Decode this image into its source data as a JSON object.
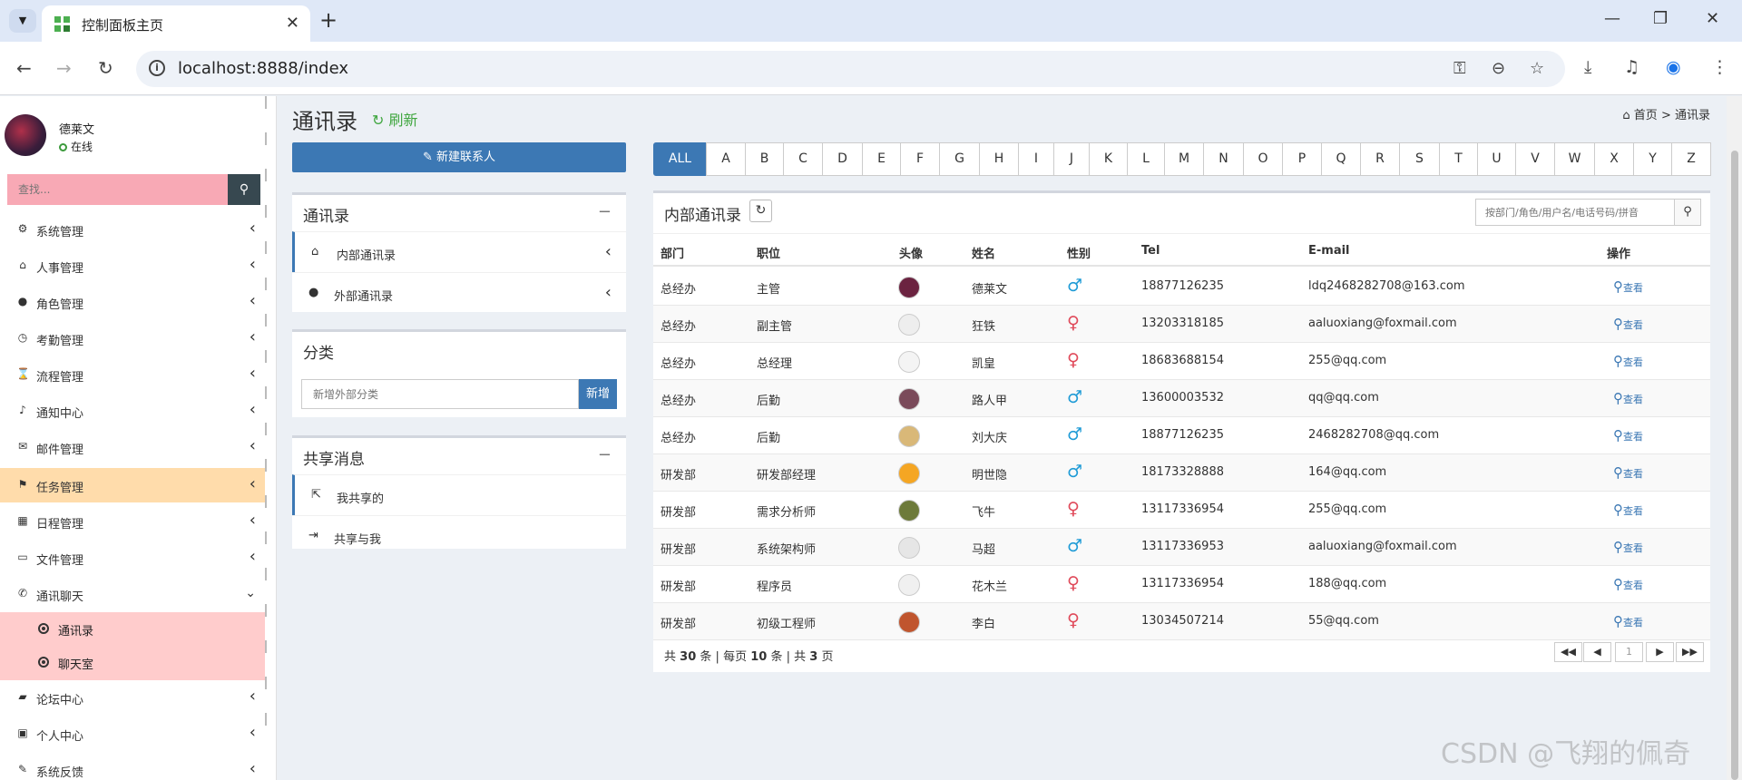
{
  "browser": {
    "tab_title": "控制面板主页",
    "url": "localhost:8888/index"
  },
  "sidebar": {
    "user": {
      "name": "德莱文",
      "status": "在线"
    },
    "search_placeholder": "查找...",
    "menu": [
      {
        "label": "系统管理",
        "icon": "gear-icon"
      },
      {
        "label": "人事管理",
        "icon": "graduation-cap-icon"
      },
      {
        "label": "角色管理",
        "icon": "user-icon"
      },
      {
        "label": "考勤管理",
        "icon": "clock-icon"
      },
      {
        "label": "流程管理",
        "icon": "hourglass-icon"
      },
      {
        "label": "通知中心",
        "icon": "bell-icon"
      },
      {
        "label": "邮件管理",
        "icon": "envelope-icon"
      },
      {
        "label": "任务管理",
        "icon": "flag-icon",
        "active": true
      },
      {
        "label": "日程管理",
        "icon": "calendar-icon"
      },
      {
        "label": "文件管理",
        "icon": "folder-open-icon"
      },
      {
        "label": "通讯聊天",
        "icon": "phone-icon",
        "expanded": true
      }
    ],
    "submenu": [
      {
        "label": "通讯录"
      },
      {
        "label": "聊天室"
      }
    ],
    "menu_bottom": [
      {
        "label": "论坛中心",
        "icon": "comment-icon"
      },
      {
        "label": "个人中心",
        "icon": "th-large-icon"
      },
      {
        "label": "系统反馈",
        "icon": "pencil-icon"
      }
    ]
  },
  "header": {
    "title": "通讯录",
    "refresh": "刷新",
    "breadcrumb_home": "首页",
    "breadcrumb_sep": ">",
    "breadcrumb_current": "通讯录"
  },
  "left_panel": {
    "new_contact": "新建联系人",
    "contacts_box": {
      "title": "通讯录",
      "items": [
        "内部通讯录",
        "外部通讯录"
      ]
    },
    "category_box": {
      "title": "分类",
      "input_placeholder": "新增外部分类",
      "add_button": "新增"
    },
    "share_box": {
      "title": "共享消息",
      "items": [
        "我共享的",
        "共享与我"
      ]
    }
  },
  "letters": [
    "ALL",
    "A",
    "B",
    "C",
    "D",
    "E",
    "F",
    "G",
    "H",
    "I",
    "J",
    "K",
    "L",
    "M",
    "N",
    "O",
    "P",
    "Q",
    "R",
    "S",
    "T",
    "U",
    "V",
    "W",
    "X",
    "Y",
    "Z"
  ],
  "table": {
    "title": "内部通讯录",
    "search_placeholder": "按部门/角色/用户名/电话号码/拼音",
    "columns": [
      "部门",
      "职位",
      "头像",
      "姓名",
      "性别",
      "Tel",
      "E-mail",
      "操作"
    ],
    "view_label": "查看",
    "rows": [
      {
        "dept": "总经办",
        "position": "主管",
        "name": "德莱文",
        "gender": "male",
        "tel": "18877126235",
        "email": "ldq2468282708@163.com",
        "avatar_color": "#6b2340"
      },
      {
        "dept": "总经办",
        "position": "副主管",
        "name": "狂铁",
        "gender": "female",
        "tel": "13203318185",
        "email": "aaluoxiang@foxmail.com",
        "avatar_color": "#eeeeee"
      },
      {
        "dept": "总经办",
        "position": "总经理",
        "name": "凯皇",
        "gender": "female",
        "tel": "18683688154",
        "email": "255@qq.com",
        "avatar_color": "#f4f4f4"
      },
      {
        "dept": "总经办",
        "position": "后勤",
        "name": "路人甲",
        "gender": "male",
        "tel": "13600003532",
        "email": "qq@qq.com",
        "avatar_color": "#7a4a5a"
      },
      {
        "dept": "总经办",
        "position": "后勤",
        "name": "刘大庆",
        "gender": "male",
        "tel": "18877126235",
        "email": "2468282708@qq.com",
        "avatar_color": "#d9b878"
      },
      {
        "dept": "研发部",
        "position": "研发部经理",
        "name": "明世隐",
        "gender": "male",
        "tel": "18173328888",
        "email": "164@qq.com",
        "avatar_color": "#f5a623"
      },
      {
        "dept": "研发部",
        "position": "需求分析师",
        "name": "飞牛",
        "gender": "female",
        "tel": "13117336954",
        "email": "255@qq.com",
        "avatar_color": "#6d7a3a"
      },
      {
        "dept": "研发部",
        "position": "系统架构师",
        "name": "马超",
        "gender": "male",
        "tel": "13117336953",
        "email": "aaluoxiang@foxmail.com",
        "avatar_color": "#e6e6e6"
      },
      {
        "dept": "研发部",
        "position": "程序员",
        "name": "花木兰",
        "gender": "female",
        "tel": "13117336954",
        "email": "188@qq.com",
        "avatar_color": "#f0f0f0"
      },
      {
        "dept": "研发部",
        "position": "初级工程师",
        "name": "李白",
        "gender": "female",
        "tel": "13034507214",
        "email": "55@qq.com",
        "avatar_color": "#c0552e"
      }
    ],
    "footer": {
      "total_prefix": "共",
      "total": "30",
      "total_unit": "条",
      "per_page_prefix": "每页",
      "per_page": "10",
      "pages_prefix": "共",
      "pages": "3",
      "pages_unit": "页"
    },
    "current_page": "1"
  },
  "watermark": "CSDN @飞翔的佩奇",
  "colors": {
    "primary": "#3c78b4",
    "active_menu": "#ffdcab",
    "submenu_bg": "#ffcccc",
    "search_bg": "#f8a9b5",
    "male": "#1f9bd6",
    "female": "#e04a5a"
  }
}
